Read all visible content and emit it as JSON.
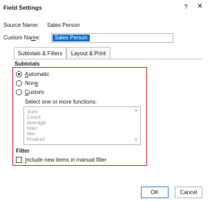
{
  "dialog": {
    "title": "Field Settings",
    "help": "?",
    "close": "✕"
  },
  "source": {
    "label": "Source Name:",
    "value": "Sales Person"
  },
  "custom": {
    "label_pre": "Custom Na",
    "label_acc": "m",
    "label_post": "e:",
    "value": "Sales Person"
  },
  "tabs": [
    {
      "label": "Subtotals & Filters"
    },
    {
      "label": "Layout & Print"
    }
  ],
  "subtotals": {
    "heading": "Subtotals",
    "automatic": {
      "acc": "A",
      "rest": "utomatic",
      "selected": true
    },
    "none": {
      "pre": "Non",
      "acc": "e",
      "selected": false
    },
    "custom": {
      "acc": "C",
      "rest": "ustom",
      "selected": false
    },
    "functions_label": "Select one or more functions:",
    "functions": [
      "Sum",
      "Count",
      "Average",
      "Max",
      "Min",
      "Product"
    ]
  },
  "filter": {
    "heading": "Filter",
    "include_acc": "I",
    "include_rest": "nclude new items in manual filter",
    "checked": false
  },
  "buttons": {
    "ok": "OK",
    "cancel": "Cancel"
  }
}
